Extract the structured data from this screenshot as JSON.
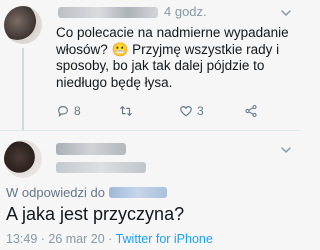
{
  "tweet": {
    "time": "4 godz.",
    "body": "Co polecacie na nadmierne wypadanie włosów? 😬 Przyjmę wszystkie rady i sposoby, bo jak tak dalej pójdzie to niedługo będę łysa.",
    "actions": {
      "replies": "8",
      "retweets": "",
      "likes": "3"
    }
  },
  "reply": {
    "in_reply_to_label": "W odpowiedzi do",
    "text": "A jaka jest przyczyna?",
    "timestamp": "13:49 · 26 mar 20 · ",
    "client": "Twitter for iPhone"
  },
  "colors": {
    "accent": "#1da1f2",
    "muted": "#657786",
    "divider": "#e1e8ed"
  },
  "icons": [
    "reply-icon",
    "retweet-icon",
    "like-icon",
    "share-icon",
    "chevron-down-icon"
  ]
}
